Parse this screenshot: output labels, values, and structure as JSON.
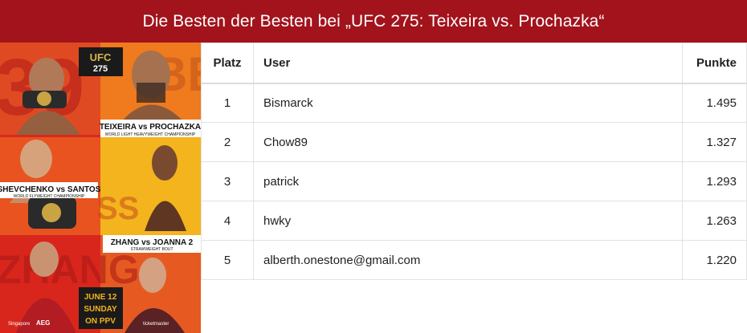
{
  "header": {
    "title": "Die Besten der Besten bei „UFC 275: Teixeira vs. Prochazka“"
  },
  "poster": {
    "logo": "UFC 275",
    "fight1": "TEIXEIRA vs PROCHAZKA",
    "fight1_sub": "WORLD LIGHT HEAVYWEIGHT CHAMPIONSHIP",
    "fight2": "SHEVCHENKO vs SANTOS",
    "fight2_sub": "WORLD FLYWEIGHT CHAMPIONSHIP",
    "fight3": "ZHANG vs JOANNA 2",
    "fight3_sub": "STRAWWEIGHT BOUT",
    "date_line1": "JUNE 12",
    "date_line2": "SUNDAY",
    "date_line3": "ON PPV",
    "sponsor1": "Singapore",
    "sponsor2": "AEG",
    "sponsor3": "ticketmaster"
  },
  "leaderboard": {
    "headers": {
      "rank": "Platz",
      "user": "User",
      "points": "Punkte"
    },
    "rows": [
      {
        "rank": "1",
        "user": "Bismarck",
        "points": "1.495"
      },
      {
        "rank": "2",
        "user": "Chow89",
        "points": "1.327"
      },
      {
        "rank": "3",
        "user": "patrick",
        "points": "1.293"
      },
      {
        "rank": "4",
        "user": "hwky",
        "points": "1.263"
      },
      {
        "rank": "5",
        "user": "alberth.onestone@gmail.com",
        "points": "1.220"
      }
    ]
  }
}
